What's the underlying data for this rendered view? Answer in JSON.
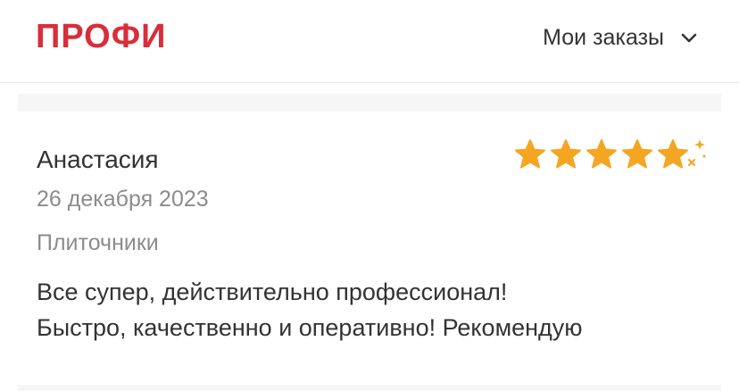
{
  "header": {
    "logo": "ПРОФИ",
    "orders_label": "Мои заказы"
  },
  "review": {
    "author": "Анастасия",
    "date": "26 декабря 2023",
    "category": "Плиточники",
    "text_line1": "Все супер, действительно профессионал!",
    "text_line2": "Быстро, качественно и оперативно! Рекомендую",
    "rating": 5
  },
  "colors": {
    "brand": "#d92d3a",
    "star": "#f4a623",
    "muted_text": "#8c8c8c"
  },
  "icons": [
    "chevron-down-icon",
    "star-icon",
    "sparkle-icon"
  ]
}
